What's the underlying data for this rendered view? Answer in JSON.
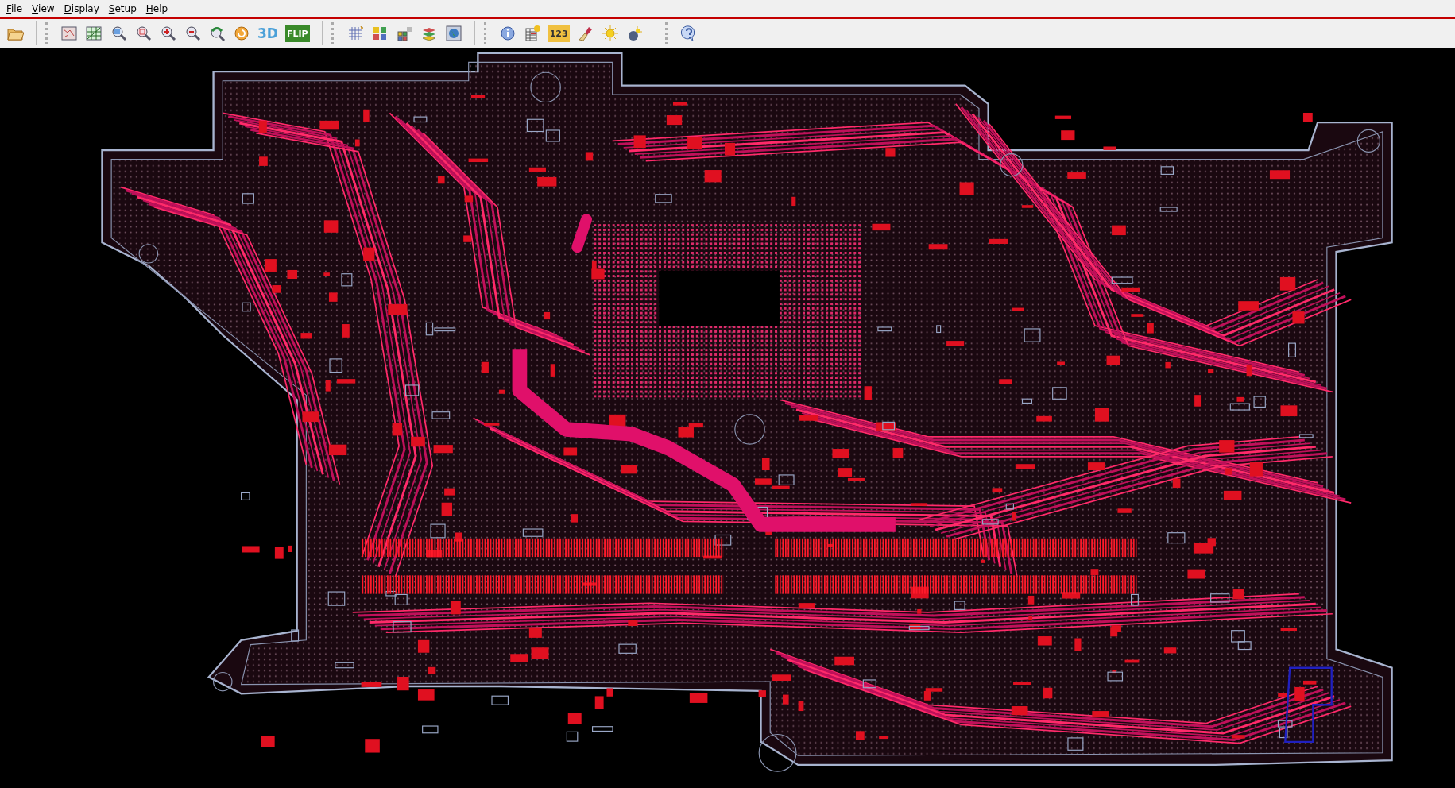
{
  "menu": [
    {
      "label": "File"
    },
    {
      "label": "View"
    },
    {
      "label": "Display"
    },
    {
      "label": "Setup"
    },
    {
      "label": "Help"
    }
  ],
  "toolbar_labels": [
    "3D",
    "FLIP",
    "123"
  ]
}
